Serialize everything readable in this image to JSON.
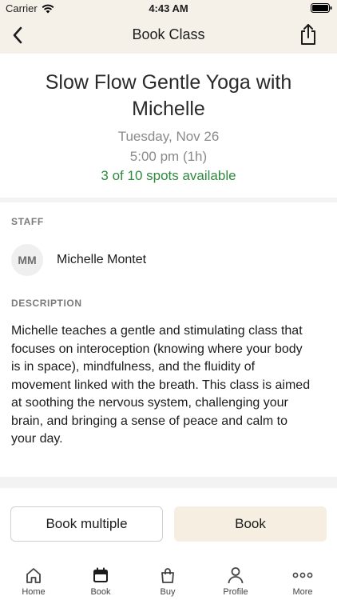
{
  "status_bar": {
    "carrier": "Carrier",
    "time": "4:43 AM"
  },
  "nav": {
    "title": "Book Class",
    "back_icon": "chevron-left-icon",
    "share_icon": "share-icon"
  },
  "class_info": {
    "title": "Slow Flow Gentle Yoga with Michelle",
    "date": "Tuesday, Nov 26",
    "time": "5:00 pm (1h)",
    "availability": "3 of 10 spots available"
  },
  "staff": {
    "label": "STAFF",
    "initials": "MM",
    "name": "Michelle Montet"
  },
  "description": {
    "label": "DESCRIPTION",
    "text": "Michelle teaches a gentle and stimulating class that focuses on interoception (knowing where your body is in space), mindfulness, and the fluidity of movement linked with the breath. This class is aimed at soothing the nervous system, challenging your brain, and bringing a sense of peace and calm to your day."
  },
  "actions": {
    "book_multiple": "Book multiple",
    "book": "Book"
  },
  "tabs": [
    {
      "label": "Home",
      "icon": "home-icon"
    },
    {
      "label": "Book",
      "icon": "calendar-icon",
      "active": true
    },
    {
      "label": "Buy",
      "icon": "shopping-bag-icon"
    },
    {
      "label": "Profile",
      "icon": "person-icon"
    },
    {
      "label": "More",
      "icon": "more-dots-icon"
    }
  ],
  "colors": {
    "header_bg": "#f6f1e8",
    "availability_green": "#2e8a3e",
    "book_button_bg": "#f6eee0",
    "secondary_text": "#8a8a8a"
  }
}
